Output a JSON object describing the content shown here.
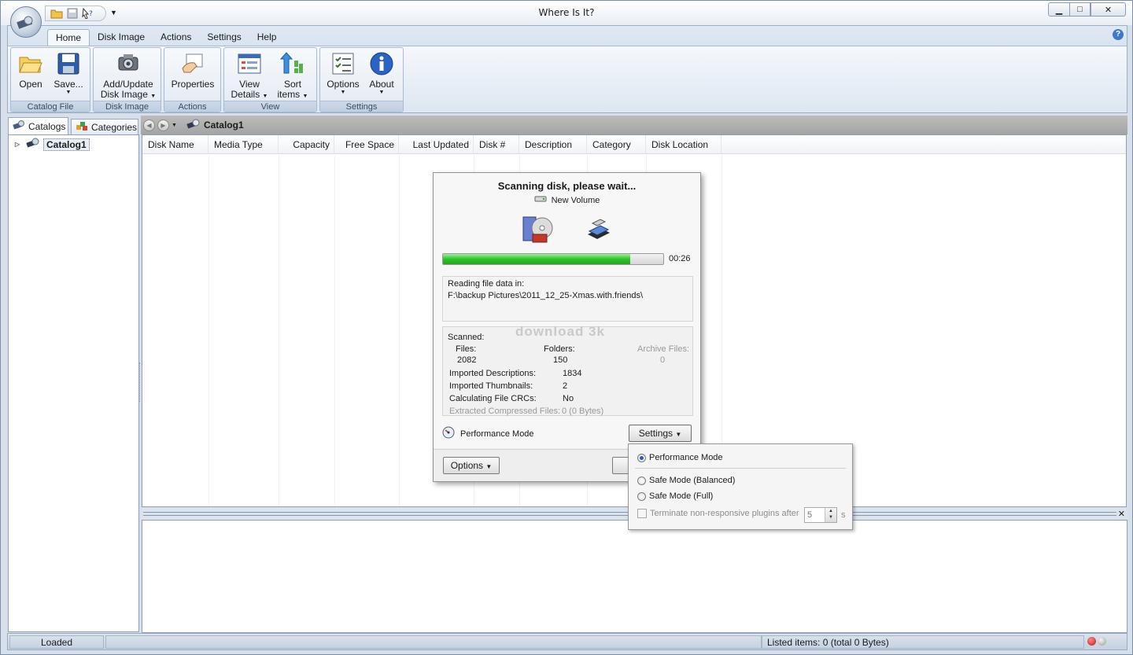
{
  "window": {
    "title": "Where Is It?"
  },
  "ribbon": {
    "tabs": [
      "Home",
      "Disk Image",
      "Actions",
      "Settings",
      "Help"
    ],
    "active_tab": "Home",
    "groups": {
      "catalog_file": {
        "label": "Catalog File",
        "open": "Open",
        "save": "Save..."
      },
      "disk_image": {
        "label": "Disk Image",
        "add_update_line1": "Add/Update",
        "add_update_line2": "Disk Image"
      },
      "actions": {
        "label": "Actions",
        "properties": "Properties"
      },
      "view": {
        "label": "View",
        "view_details_line1": "View",
        "view_details_line2": "Details",
        "sort_items_line1": "Sort",
        "sort_items_line2": "items"
      },
      "settings": {
        "label": "Settings",
        "options": "Options",
        "about": "About"
      }
    }
  },
  "left_panel": {
    "tabs": [
      "Catalogs",
      "Categories"
    ],
    "tree": [
      {
        "label": "Catalog1"
      }
    ]
  },
  "address_bar": {
    "location": "Catalog1"
  },
  "grid": {
    "columns": [
      "Disk Name",
      "Media Type",
      "Capacity",
      "Free Space",
      "Last Updated",
      "Disk #",
      "Description",
      "Category",
      "Disk Location"
    ]
  },
  "scan_dialog": {
    "title": "Scanning disk, please wait...",
    "volume": "New Volume",
    "progress_fraction": 0.85,
    "elapsed": "00:26",
    "reading_label": "Reading file data in:",
    "reading_path": "F:\\backup Pictures\\2011_12_25-Xmas.with.friends\\",
    "watermark": "download 3k",
    "scanned_label": "Scanned:",
    "files_label": "Files:",
    "files_value": "2082",
    "folders_label": "Folders:",
    "folders_value": "150",
    "archive_label": "Archive Files:",
    "archive_value": "0",
    "imported_desc_label": "Imported Descriptions:",
    "imported_desc_value": "1834",
    "imported_thumb_label": "Imported Thumbnails:",
    "imported_thumb_value": "2",
    "crc_label": "Calculating File CRCs:",
    "crc_value": "No",
    "extracted_label": "Extracted Compressed Files:",
    "extracted_value": "0 (0 Bytes)",
    "mode_label": "Performance Mode",
    "settings_button": "Settings",
    "options_button": "Options"
  },
  "settings_menu": {
    "items": [
      {
        "label": "Performance Mode",
        "checked": true
      },
      {
        "label": "Safe Mode (Balanced)",
        "checked": false
      },
      {
        "label": "Safe Mode (Full)",
        "checked": false
      }
    ],
    "terminate_label": "Terminate non-responsive plugins after",
    "terminate_value": "5",
    "terminate_unit": "s"
  },
  "status_bar": {
    "state": "Loaded",
    "listed_items": "Listed items: 0 (total 0 Bytes)"
  },
  "colors": {
    "progress_green": "#2fc22a",
    "accent_blue": "#3f78c9"
  }
}
